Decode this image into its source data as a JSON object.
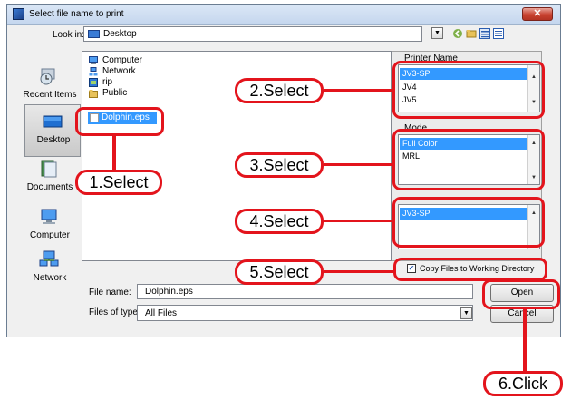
{
  "dialog": {
    "title": "Select file name to print",
    "close_symbol": "✕"
  },
  "look_in": {
    "label": "Look in:",
    "value": "Desktop"
  },
  "places": [
    {
      "label": "Recent Items"
    },
    {
      "label": "Desktop"
    },
    {
      "label": "Documents"
    },
    {
      "label": "Computer"
    },
    {
      "label": "Network"
    }
  ],
  "files": [
    {
      "name": "Computer"
    },
    {
      "name": "Network"
    },
    {
      "name": "rip"
    },
    {
      "name": "Public"
    },
    {
      "name": "Dolphin.eps"
    }
  ],
  "printer": {
    "label": "Printer Name",
    "options": [
      "JV3-SP",
      "JV4",
      "JV5"
    ],
    "selected": "JV3-SP"
  },
  "mode": {
    "label": "Mode",
    "options": [
      "Full Color",
      "MRL"
    ],
    "selected": "Full Color"
  },
  "third_list": {
    "options": [
      "JV3-SP"
    ],
    "selected": "JV3-SP"
  },
  "copy_files": {
    "label": "Copy Files to Working Directory",
    "checked": true
  },
  "file_name": {
    "label": "File name:",
    "value": "Dolphin.eps"
  },
  "file_type": {
    "label": "Files of type:",
    "value": "All Files"
  },
  "buttons": {
    "open": "Open",
    "cancel": "Cancel"
  },
  "annotations": [
    "1.Select",
    "2.Select",
    "3.Select",
    "4.Select",
    "5.Select",
    "6.Click"
  ],
  "colors": {
    "annotation_red": "#e3141c",
    "selection_blue": "#3399ff"
  }
}
